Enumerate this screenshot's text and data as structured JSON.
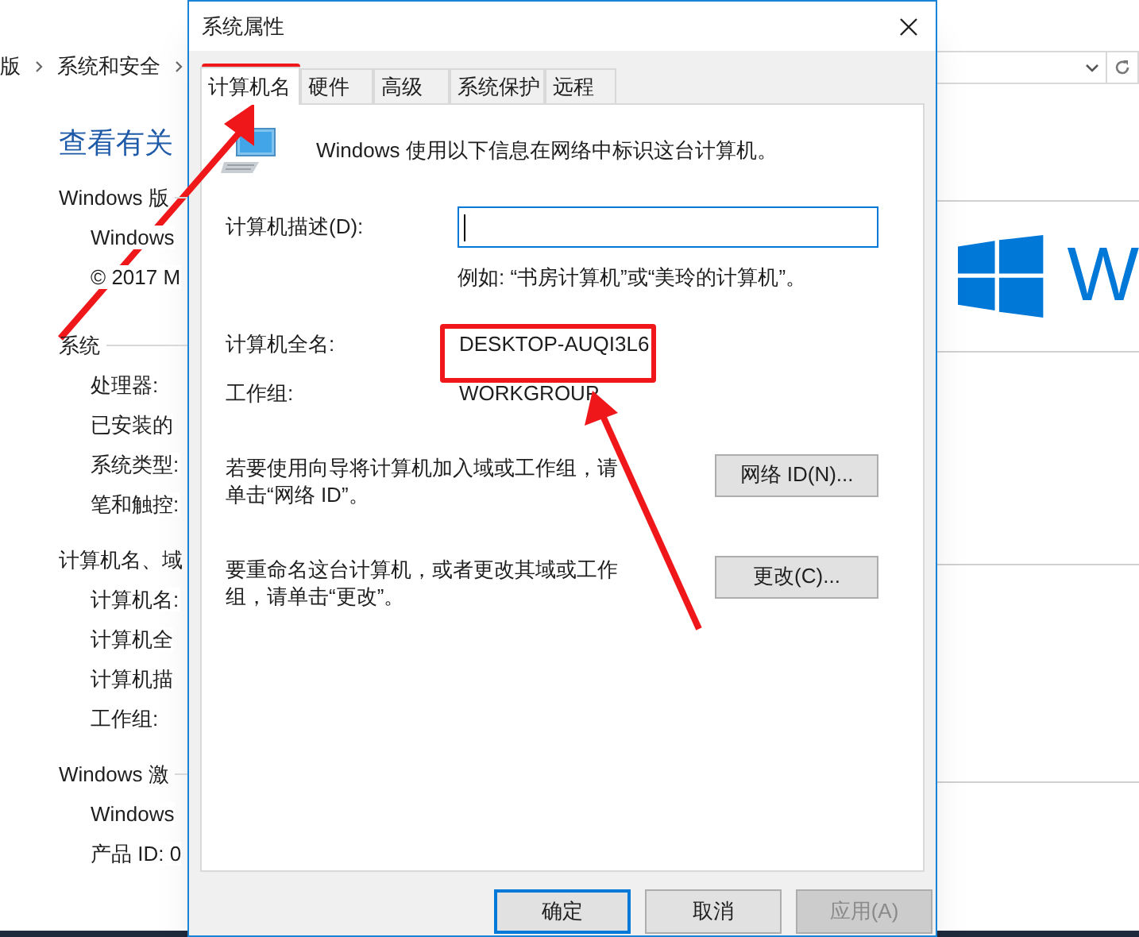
{
  "background_window": {
    "breadcrumb": [
      "版",
      "系统和安全"
    ],
    "heading": "查看有关",
    "sections": [
      {
        "title": "Windows 版",
        "items": [
          "Windows",
          "© 2017 M"
        ]
      },
      {
        "title": "系统",
        "items": [
          "处理器:",
          "已安装的",
          "系统类型:",
          "笔和触控:"
        ]
      },
      {
        "title": "计算机名、域",
        "items": [
          "计算机名:",
          "计算机全",
          "计算机描",
          "工作组:"
        ]
      },
      {
        "title": "Windows 激",
        "items": [
          "Windows",
          "产品 ID: 0"
        ]
      }
    ],
    "logo_text": "W"
  },
  "dialog": {
    "title": "系统属性",
    "tabs": [
      {
        "label": "计算机名",
        "selected": true
      },
      {
        "label": "硬件",
        "selected": false
      },
      {
        "label": "高级",
        "selected": false
      },
      {
        "label": "系统保护",
        "selected": false
      },
      {
        "label": "远程",
        "selected": false
      }
    ],
    "intro": "Windows 使用以下信息在网络中标识这台计算机。",
    "description_label": "计算机描述(D):",
    "description_field": {
      "focused": true
    },
    "example": "例如: “书房计算机”或“美玲的计算机”。",
    "full_name_label": "计算机全名:",
    "full_name": "DESKTOP-AUQI3L6",
    "workgroup_label": "工作组:",
    "workgroup": "WORKGROUP",
    "join_text": "若要使用向导将计算机加入域或工作组，请单击“网络 ID”。",
    "network_id_button": "网络 ID(N)...",
    "rename_text": "要重命名这台计算机，或者更改其域或工作组，请单击“更改”。",
    "change_button": "更改(C)...",
    "footer_buttons": [
      {
        "label": "确定",
        "default": true,
        "disabled": false
      },
      {
        "label": "取消",
        "default": false,
        "disabled": false
      },
      {
        "label": "应用(A)",
        "default": false,
        "disabled": true
      }
    ]
  }
}
